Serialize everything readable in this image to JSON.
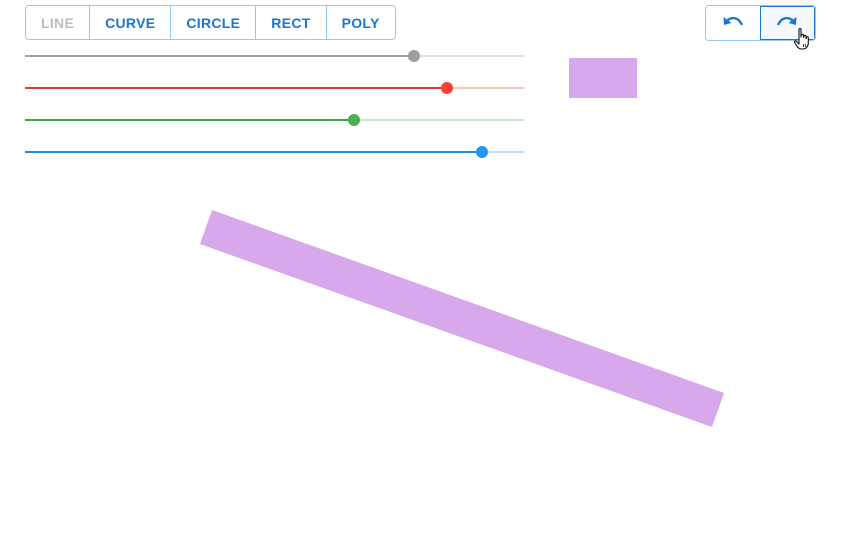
{
  "toolbar": {
    "tools": [
      {
        "label": "LINE",
        "disabled": true
      },
      {
        "label": "CURVE",
        "disabled": false
      },
      {
        "label": "CIRCLE",
        "disabled": false
      },
      {
        "label": "RECT",
        "disabled": false
      },
      {
        "label": "POLY",
        "disabled": false
      }
    ]
  },
  "history": {
    "undo_icon": "undo-icon",
    "redo_icon": "redo-icon"
  },
  "color_sliders": [
    {
      "channel": "alpha",
      "value": 0.78,
      "thumb_color": "#9e9e9e",
      "fill_color": "#9e9e9e",
      "rail_color": "#e0e0e0"
    },
    {
      "channel": "red",
      "value": 0.845,
      "thumb_color": "#f44336",
      "fill_color": "#e53935",
      "rail_color": "#f8c4c1"
    },
    {
      "channel": "green",
      "value": 0.66,
      "thumb_color": "#4caf50",
      "fill_color": "#43a047",
      "rail_color": "#c8e6c9"
    },
    {
      "channel": "blue",
      "value": 0.915,
      "thumb_color": "#2196f3",
      "fill_color": "#1e88e5",
      "rail_color": "#bbdefb"
    }
  ],
  "color_preview": {
    "color": "#d7a8ec"
  },
  "canvas": {
    "shape_type": "line",
    "stroke_color": "#d7a8ec"
  }
}
